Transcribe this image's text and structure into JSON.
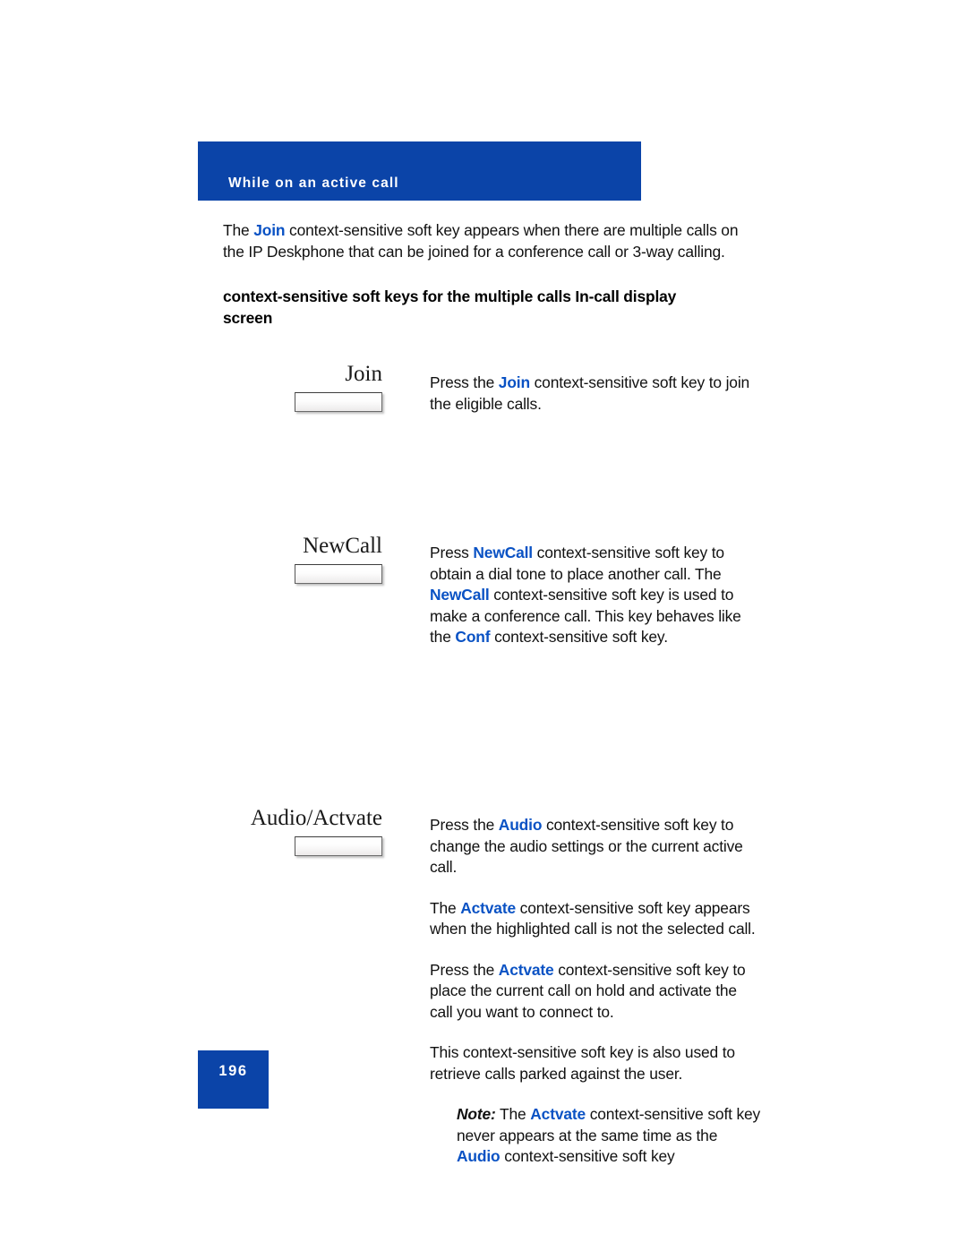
{
  "header": {
    "title": "While on an active call",
    "bar_color": "#0b44a8"
  },
  "colors": {
    "banner_blue": "#0b44a8",
    "keyword_blue": "#0a52c4",
    "body_text": "#111111"
  },
  "intro": {
    "part1": "The ",
    "keyword": "Join",
    "part2": " context-sensitive soft key appears when there are multiple calls on the IP Deskphone that can be joined for a conference call or 3-way calling."
  },
  "subhead": {
    "text": "context-sensitive soft keys for the multiple calls In-call display screen"
  },
  "softkeys": [
    {
      "label": "Join",
      "button_name": "softkey-button-join",
      "paragraphs": [
        {
          "segments": [
            {
              "text": "Press the ",
              "style": "plain"
            },
            {
              "text": "Join",
              "style": "keyword"
            },
            {
              "text": " context-sensitive soft key to join the eligible calls.",
              "style": "plain"
            }
          ]
        }
      ]
    },
    {
      "label": "NewCall",
      "button_name": "softkey-button-newcall",
      "paragraphs": [
        {
          "segments": [
            {
              "text": "Press ",
              "style": "plain"
            },
            {
              "text": "NewCall",
              "style": "keyword"
            },
            {
              "text": " context-sensitive soft key to obtain a dial tone to place another call. The ",
              "style": "plain"
            },
            {
              "text": "NewCall",
              "style": "keyword"
            },
            {
              "text": " context-sensitive soft key is used to make a conference call. This key behaves like the ",
              "style": "plain"
            },
            {
              "text": "Conf",
              "style": "keyword"
            },
            {
              "text": " context-sensitive soft key.",
              "style": "plain"
            }
          ]
        }
      ]
    },
    {
      "label": "Audio/Actvate",
      "button_name": "softkey-button-audio-actvate",
      "paragraphs": [
        {
          "segments": [
            {
              "text": "Press the ",
              "style": "plain"
            },
            {
              "text": "Audio",
              "style": "keyword"
            },
            {
              "text": " context-sensitive soft key to change the audio settings or the current active call.",
              "style": "plain"
            }
          ]
        },
        {
          "segments": [
            {
              "text": "The ",
              "style": "plain"
            },
            {
              "text": "Actvate",
              "style": "keyword"
            },
            {
              "text": " context-sensitive soft key appears when the highlighted call is not the selected call.",
              "style": "plain"
            }
          ]
        },
        {
          "segments": [
            {
              "text": "Press the ",
              "style": "plain"
            },
            {
              "text": "Actvate",
              "style": "keyword"
            },
            {
              "text": " context-sensitive soft key to place the current call on hold and activate the call you want to connect to.",
              "style": "plain"
            }
          ]
        },
        {
          "segments": [
            {
              "text": "This context-sensitive soft key is also used to retrieve calls parked against the user.",
              "style": "plain"
            }
          ]
        },
        {
          "note": true,
          "segments": [
            {
              "text": "Note:",
              "style": "note-label"
            },
            {
              "text": " The ",
              "style": "plain"
            },
            {
              "text": "Actvate",
              "style": "keyword"
            },
            {
              "text": " context-sensitive soft key never appears at the same time as the ",
              "style": "plain"
            },
            {
              "text": "Audio",
              "style": "keyword"
            },
            {
              "text": " context-sensitive soft key",
              "style": "plain"
            }
          ]
        }
      ]
    }
  ],
  "footer": {
    "page_number": "196"
  }
}
